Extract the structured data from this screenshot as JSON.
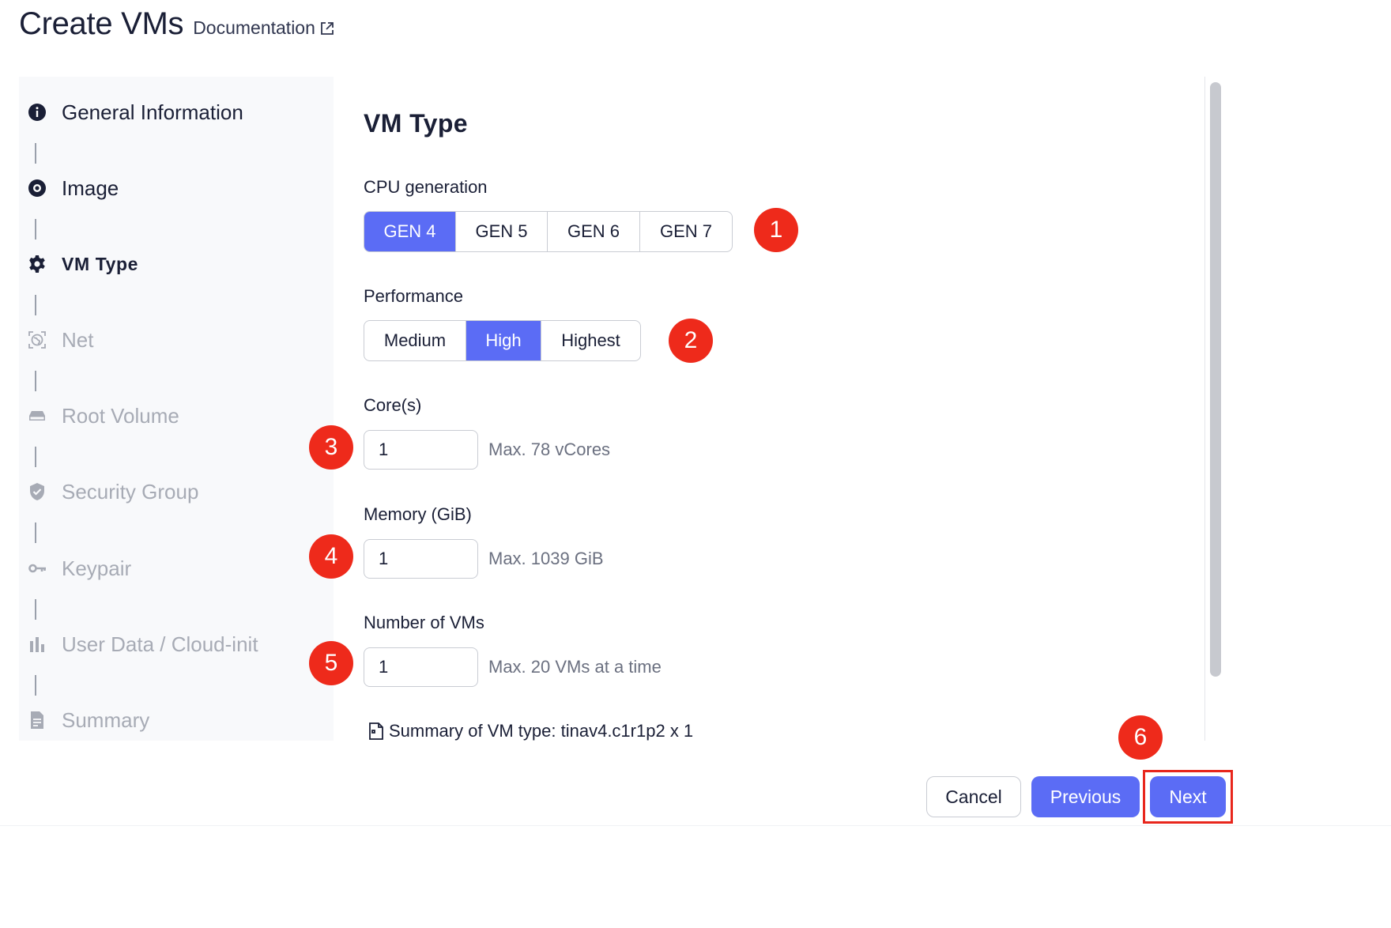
{
  "header": {
    "title": "Create VMs",
    "doc_link": "Documentation"
  },
  "steps": [
    {
      "label": "General Information",
      "icon": "info-icon",
      "state": "done"
    },
    {
      "label": "Image",
      "icon": "radio-icon",
      "state": "done"
    },
    {
      "label": "VM Type",
      "icon": "gear-icon",
      "state": "active"
    },
    {
      "label": "Net",
      "icon": "globe-icon",
      "state": "todo"
    },
    {
      "label": "Root Volume",
      "icon": "drive-icon",
      "state": "todo"
    },
    {
      "label": "Security Group",
      "icon": "shield-icon",
      "state": "todo"
    },
    {
      "label": "Keypair",
      "icon": "key-icon",
      "state": "todo"
    },
    {
      "label": "User Data / Cloud-init",
      "icon": "bar-chart-icon",
      "state": "todo"
    },
    {
      "label": "Summary",
      "icon": "file-icon",
      "state": "todo"
    }
  ],
  "vm_type": {
    "title": "VM Type",
    "cpu_label": "CPU generation",
    "cpu_options": [
      "GEN 4",
      "GEN 5",
      "GEN 6",
      "GEN 7"
    ],
    "cpu_selected": "GEN 4",
    "performance_label": "Performance",
    "performance_options": [
      "Medium",
      "High",
      "Highest"
    ],
    "performance_selected": "High",
    "cores_label": "Core(s)",
    "cores_value": "1",
    "cores_hint": "Max. 78 vCores",
    "memory_label": "Memory (GiB)",
    "memory_value": "1",
    "memory_hint": "Max. 1039 GiB",
    "vms_label": "Number of VMs",
    "vms_value": "1",
    "vms_hint": "Max. 20 VMs at a time",
    "summary": "Summary of VM type: tinav4.c1r1p2 x 1"
  },
  "badges": [
    "1",
    "2",
    "3",
    "4",
    "5",
    "6"
  ],
  "footer": {
    "cancel": "Cancel",
    "previous": "Previous",
    "next": "Next"
  },
  "colors": {
    "accent": "#5b6cf5",
    "badge": "#ee2a1b",
    "muted": "#a7abb5"
  }
}
